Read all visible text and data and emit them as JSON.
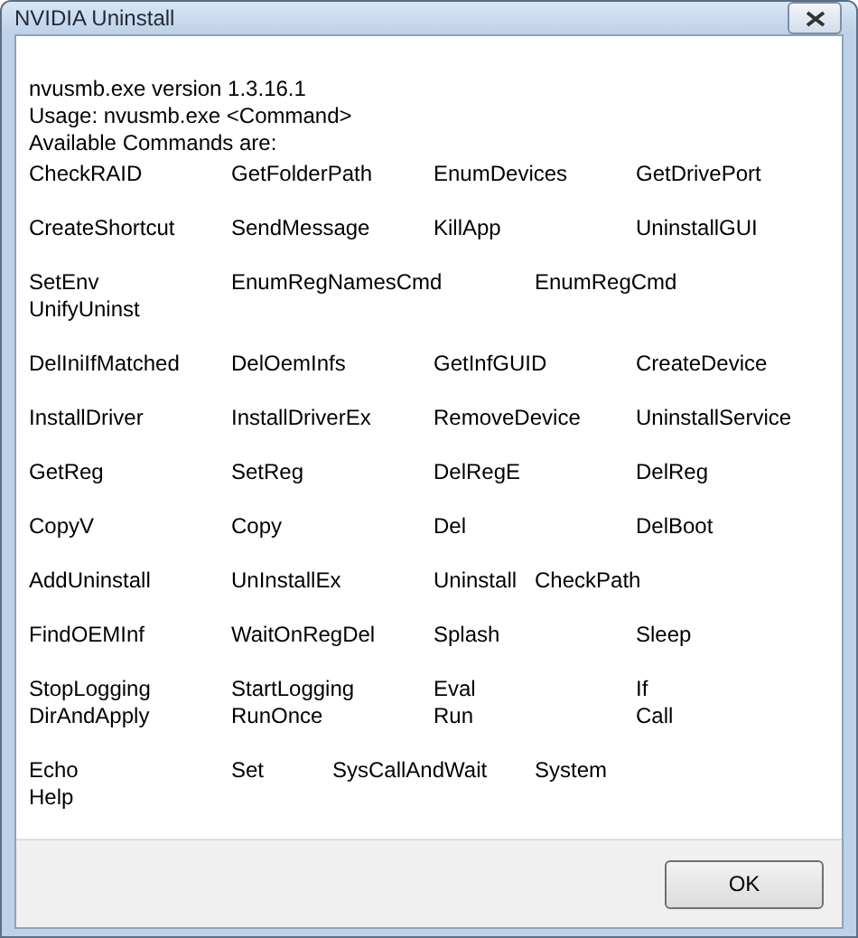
{
  "window": {
    "title": "NVIDIA Uninstall"
  },
  "message": {
    "header": [
      "nvusmb.exe version 1.3.16.1",
      "Usage: nvusmb.exe <Command>",
      "Available Commands are:"
    ],
    "blocks": [
      [
        "CheckRAID\tGetFolderPath\tEnumDevices\tGetDrivePort"
      ],
      [
        "CreateShortcut\tSendMessage\tKillApp\t\tUninstallGUI"
      ],
      [
        "SetEnv\t\tEnumRegNamesCmd\tEnumRegCmd",
        "UnifyUninst"
      ],
      [
        "DelIniIfMatched\tDelOemInfs\tGetInfGUID\tCreateDevice"
      ],
      [
        "InstallDriver\tInstallDriverEx\tRemoveDevice\tUninstallService"
      ],
      [
        "GetReg\t\tSetReg\t\tDelRegE\t\tDelReg"
      ],
      [
        "CopyV\t\tCopy\t\tDel\t\tDelBoot"
      ],
      [
        "AddUninstall\tUnInstallEx\tUninstall\tCheckPath"
      ],
      [
        "FindOEMInf\tWaitOnRegDel\tSplash\t\tSleep"
      ],
      [
        "StopLogging\tStartLogging\tEval\t\tIf",
        "DirAndApply\tRunOnce\t\tRun\t\tCall"
      ],
      [
        "Echo\t\tSet\tSysCallAndWait\tSystem",
        "Help"
      ]
    ]
  },
  "buttons": [
    "OK"
  ]
}
